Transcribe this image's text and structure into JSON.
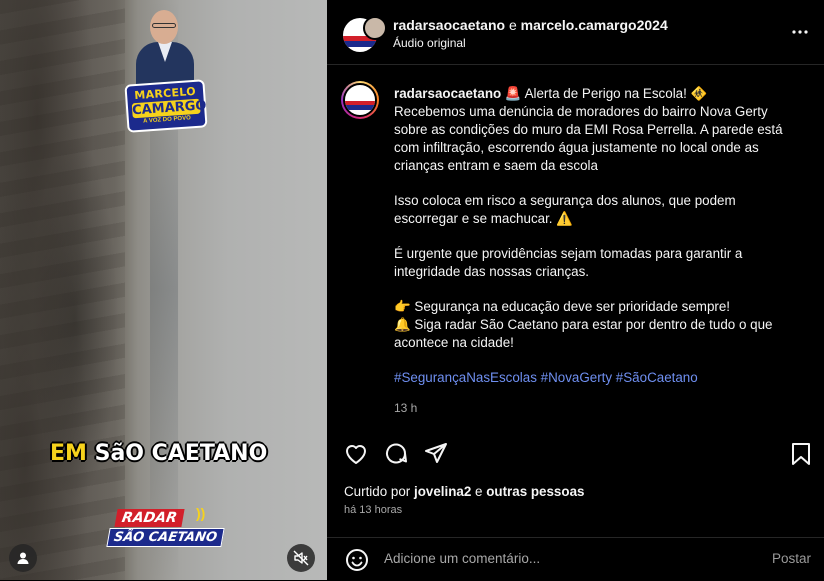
{
  "media": {
    "badge_line1": "MARCELO",
    "badge_line2": "CAMARGO",
    "badge_line3": "A VOZ DO POVO",
    "caption_prefix": "EM",
    "caption_main": "SãO CAETANO",
    "logo_line1": "RADAR",
    "logo_line2": "SÃO CAETANO"
  },
  "header": {
    "account1": "radarsaocaetano",
    "joiner": "e",
    "account2": "marcelo.camargo2024",
    "audio": "Áudio original"
  },
  "post": {
    "username": "radarsaocaetano",
    "line1": "🚨 Alerta de Perigo na Escola! 🚸",
    "para1": "Recebemos uma denúncia de moradores do bairro Nova Gerty sobre as condições do muro da EMI Rosa Perrella. A parede está com infiltração, escorrendo água justamente no local onde as crianças entram e saem da escola",
    "para2": "Isso coloca em risco a segurança dos alunos, que podem escorregar e se machucar. ⚠️",
    "para3": "É urgente que providências sejam tomadas para garantir a integridade das nossas crianças.",
    "para4a": "👉 Segurança na educação deve ser prioridade sempre!",
    "para4b": "🔔 Siga radar São Caetano para estar por dentro de tudo o que acontece na cidade!",
    "hashtags": "#SegurançaNasEscolas #NovaGerty #SãoCaetano",
    "time": "13 h"
  },
  "likes": {
    "prefix": "Curtido por",
    "user": "jovelina2",
    "joiner": "e",
    "others": "outras pessoas",
    "ago": "há 13 horas"
  },
  "comment": {
    "placeholder": "Adicione um comentário...",
    "post_label": "Postar"
  },
  "colors": {
    "background": "#000000",
    "hashtag": "#6f8ff0",
    "muted": "#a8a8a8",
    "badge_yellow": "#f6d21c",
    "badge_blue": "#1c2a8c",
    "logo_red": "#d21f2a"
  },
  "icons": [
    "profile-icon",
    "mute-icon",
    "more-icon",
    "heart-icon",
    "comment-icon",
    "share-icon",
    "bookmark-icon",
    "emoji-icon"
  ]
}
